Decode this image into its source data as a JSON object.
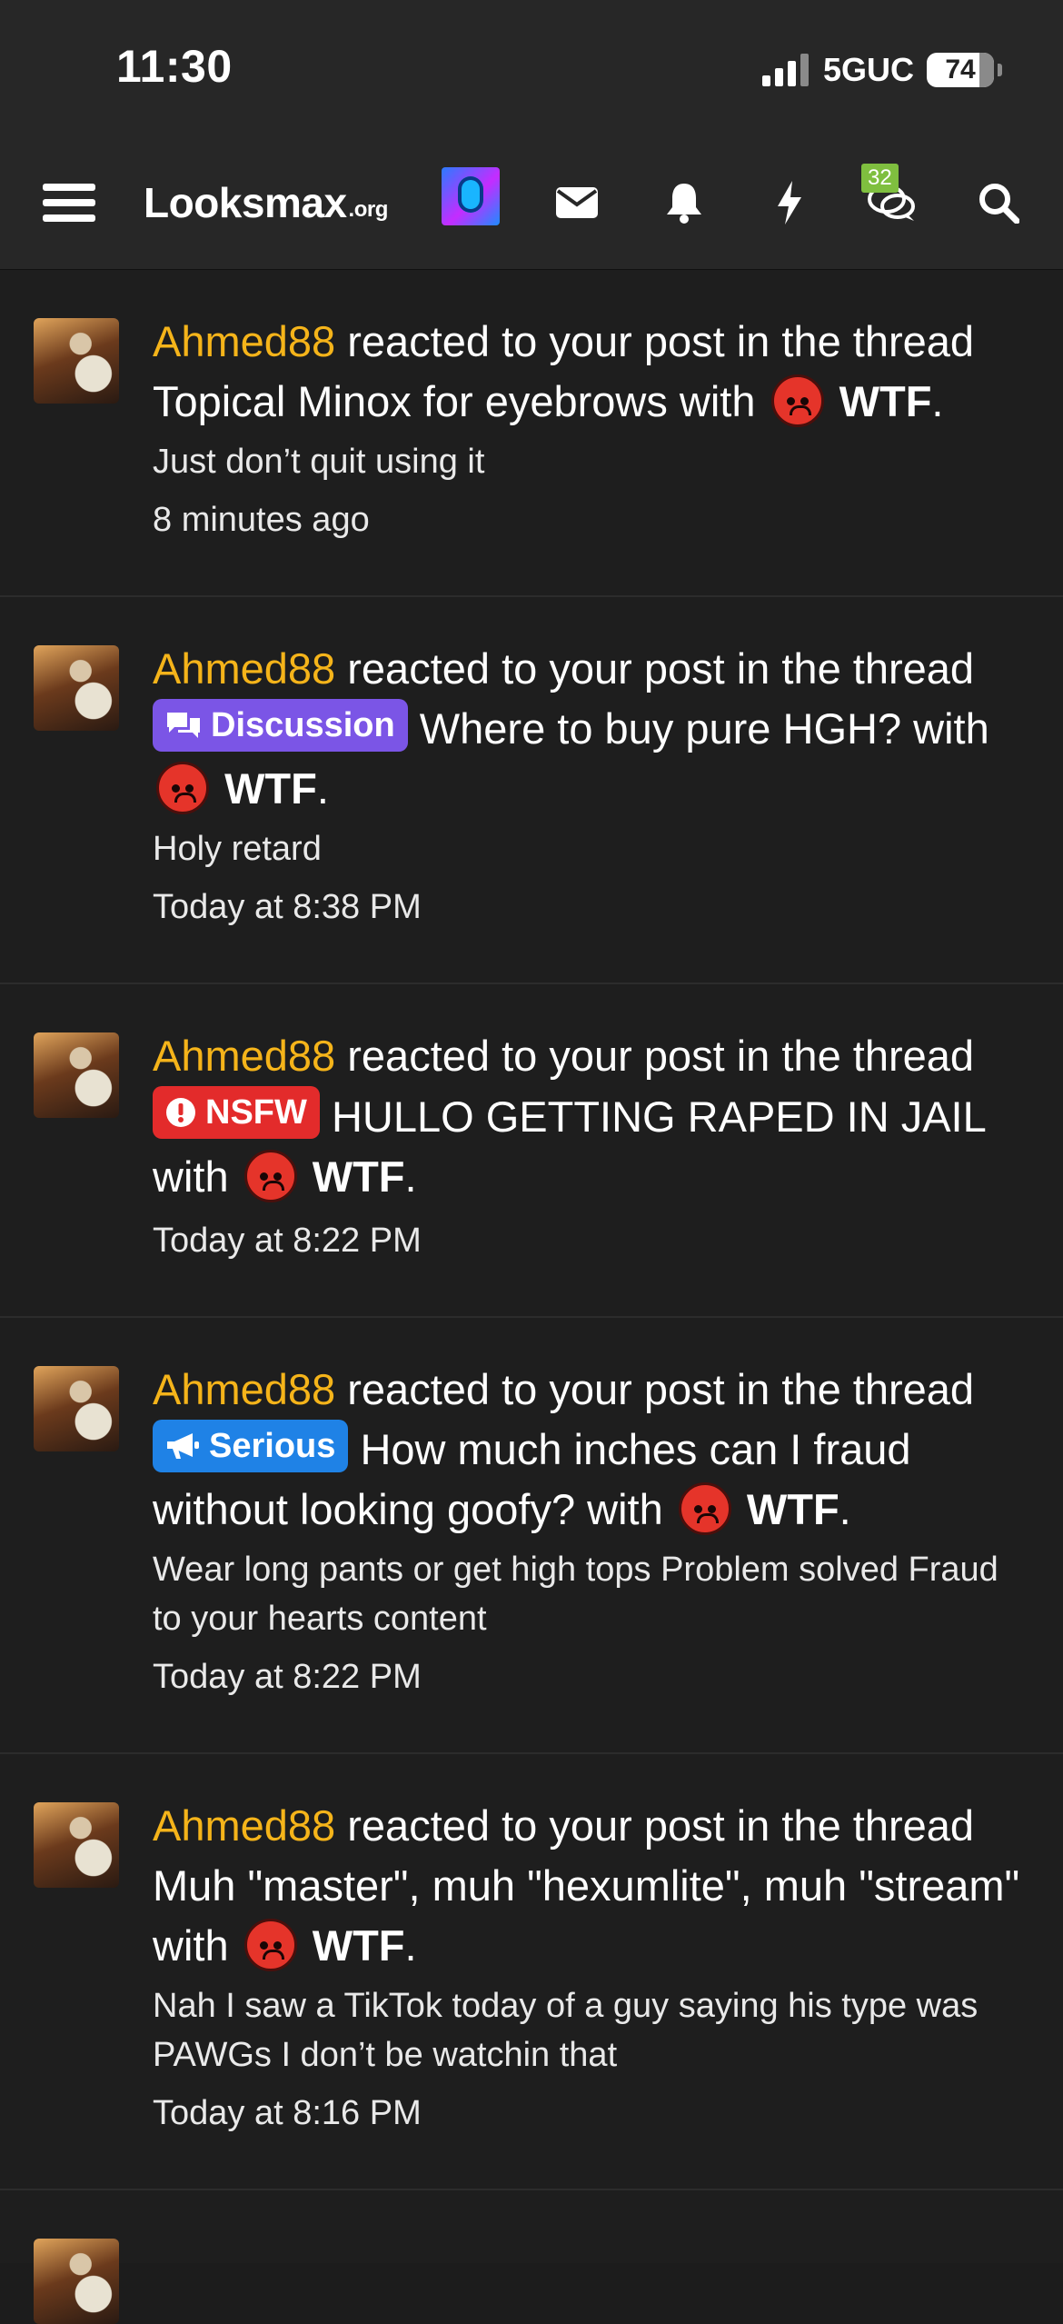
{
  "status_bar": {
    "time": "11:30",
    "network": "5GUC",
    "battery": "74"
  },
  "navbar": {
    "logo": "Looksmax",
    "logo_suffix": ".org",
    "chat_badge": "32"
  },
  "notifications": [
    {
      "user": "Ahmed88",
      "action": "reacted to your post in the thread",
      "prefix": null,
      "thread": "Topical Minox for eyebrows",
      "with": "with",
      "reaction": "WTF",
      "snippet": "Just don’t quit using it",
      "time": "8 minutes ago"
    },
    {
      "user": "Ahmed88",
      "action": "reacted to your post in the thread",
      "prefix": "Discussion",
      "thread": "Where to buy pure HGH?",
      "with": "with",
      "reaction": "WTF",
      "snippet": "Holy retard",
      "time": "Today at 8:38 PM"
    },
    {
      "user": "Ahmed88",
      "action": "reacted to your post in the thread",
      "prefix": "NSFW",
      "thread": "HULLO GETTING RAPED IN JAIL",
      "with": "with",
      "reaction": "WTF",
      "snippet": "",
      "time": "Today at 8:22 PM"
    },
    {
      "user": "Ahmed88",
      "action": "reacted to your post in the thread",
      "prefix": "Serious",
      "thread": "How much inches can I fraud without looking goofy?",
      "with": "with",
      "reaction": "WTF",
      "snippet": "Wear long pants or get high tops Problem solved Fraud to your hearts content",
      "time": "Today at 8:22 PM"
    },
    {
      "user": "Ahmed88",
      "action": "reacted to your post in the thread",
      "prefix": null,
      "thread": "Muh \"master\", muh \"hexumlite\", muh \"stream\"",
      "with": "with",
      "reaction": "WTF",
      "snippet": "Nah I saw a TikTok today of a guy saying his type was PAWGs I don’t be watchin that",
      "time": "Today at 8:16 PM"
    }
  ],
  "colors": {
    "username": "#f5b41a",
    "discussion": "#7b55e6",
    "nsfw": "#e32b2b",
    "serious": "#1f82e6"
  }
}
